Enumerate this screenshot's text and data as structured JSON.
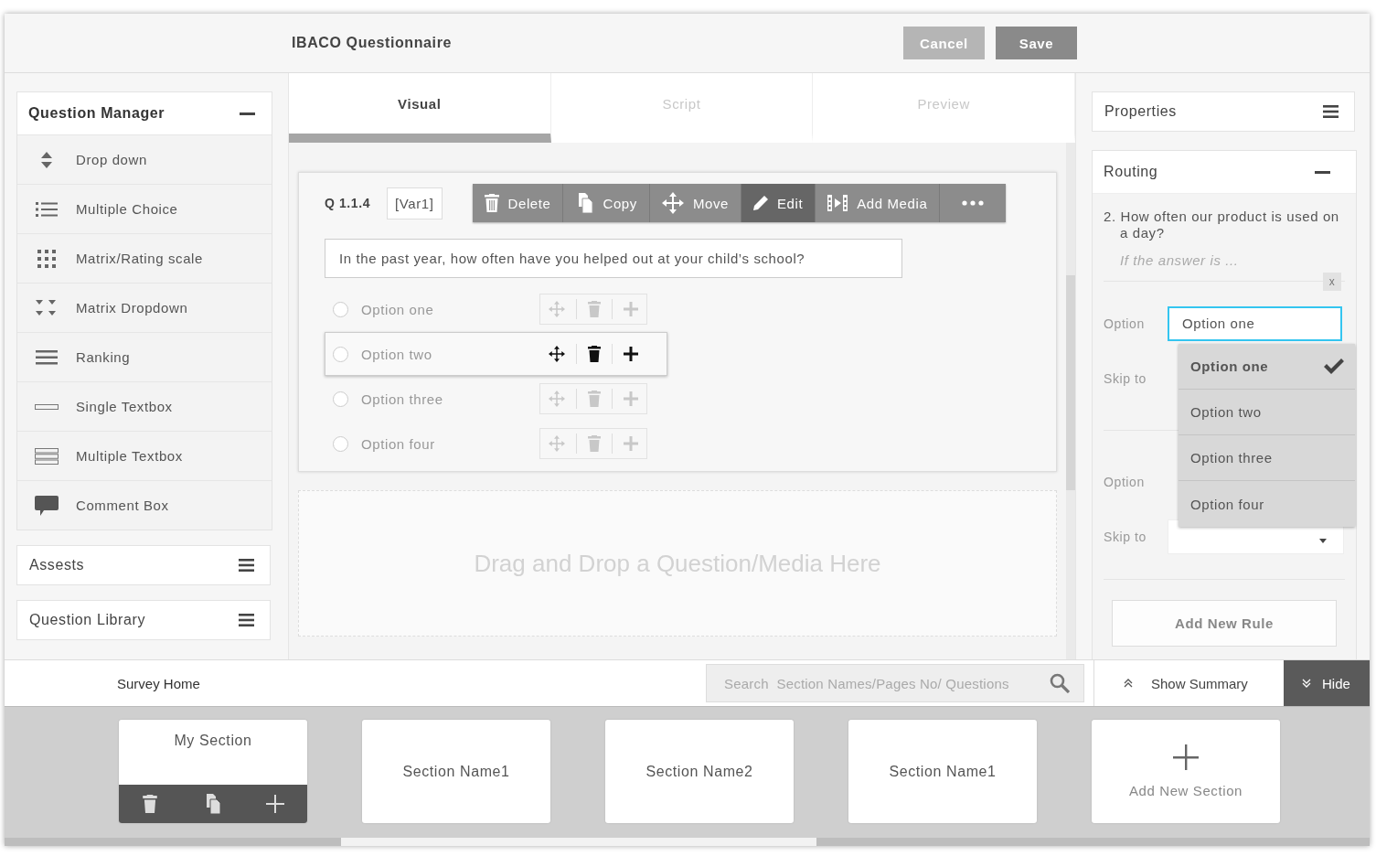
{
  "header": {
    "title": "IBACO Questionnaire",
    "buttons": [
      {
        "label": "Cancel",
        "disabled": true
      },
      {
        "label": "Save",
        "disabled": false
      }
    ]
  },
  "question_manager": {
    "title": "Question Manager",
    "expanded": true,
    "items": [
      {
        "label": "Drop down",
        "kind": "dropdown"
      },
      {
        "label": "Multiple Choice",
        "kind": "list"
      },
      {
        "label": "Matrix/Rating scale",
        "kind": "grid"
      },
      {
        "label": "Matrix Dropdown",
        "kind": "matrix-dropdown"
      },
      {
        "label": "Ranking",
        "kind": "ranking"
      },
      {
        "label": "Single Textbox",
        "kind": "single-textbox"
      },
      {
        "label": "Multiple Textbox",
        "kind": "multi-textbox"
      },
      {
        "label": "Comment Box",
        "kind": "comment"
      }
    ]
  },
  "panels": [
    {
      "title": "Assests"
    },
    {
      "title": "Question Library"
    }
  ],
  "tabs": [
    {
      "label": "Visual",
      "selected": true
    },
    {
      "label": "Script",
      "selected": false
    },
    {
      "label": "Preview",
      "selected": false
    }
  ],
  "question": {
    "number": "Q 1.1.4",
    "variable": "[Var1]",
    "toolbar": [
      {
        "label": "Delete",
        "kind": "trash",
        "selected": false
      },
      {
        "label": "Copy",
        "kind": "copy",
        "selected": false
      },
      {
        "label": "Move",
        "kind": "move",
        "selected": false
      },
      {
        "label": "Edit",
        "kind": "edit",
        "selected": true
      },
      {
        "label": "Add Media",
        "kind": "media",
        "selected": false
      }
    ],
    "text": "In the past year, how often have you helped out at your child’s school?",
    "options": [
      {
        "label": "Option one",
        "selected": false
      },
      {
        "label": "Option two",
        "selected": true
      },
      {
        "label": "Option three",
        "selected": false
      },
      {
        "label": "Option four",
        "selected": false
      }
    ]
  },
  "drop_zone": "Drag and Drop a Question/Media Here",
  "properties": {
    "title": "Properties"
  },
  "routing": {
    "title": "Routing",
    "expanded": true,
    "question": "2. How often our product is used on a day?",
    "hint": "If the answer is ...",
    "close": "x",
    "rules": [
      {
        "option_label": "Option",
        "skip_label": "Skip to"
      },
      {
        "option_label": "Option",
        "skip_label": "Skip to"
      }
    ],
    "option_value": "Option one",
    "dropdown": [
      {
        "label": "Option one",
        "selected": true
      },
      {
        "label": "Option two",
        "selected": false
      },
      {
        "label": "Option three",
        "selected": false
      },
      {
        "label": "Option four",
        "selected": false
      }
    ],
    "add_rule": "Add New Rule"
  },
  "bottom_bar": {
    "home": "Survey Home",
    "search_placeholder": "Search  Section Names/Pages No/ Questions",
    "show_summary": "Show Summary",
    "hide": "Hide"
  },
  "sections": [
    {
      "name": "My Section",
      "selected": true
    },
    {
      "name": "Section Name1",
      "selected": false
    },
    {
      "name": "Section Name2",
      "selected": false
    },
    {
      "name": "Section Name1",
      "selected": false
    }
  ],
  "add_section": "Add New Section"
}
